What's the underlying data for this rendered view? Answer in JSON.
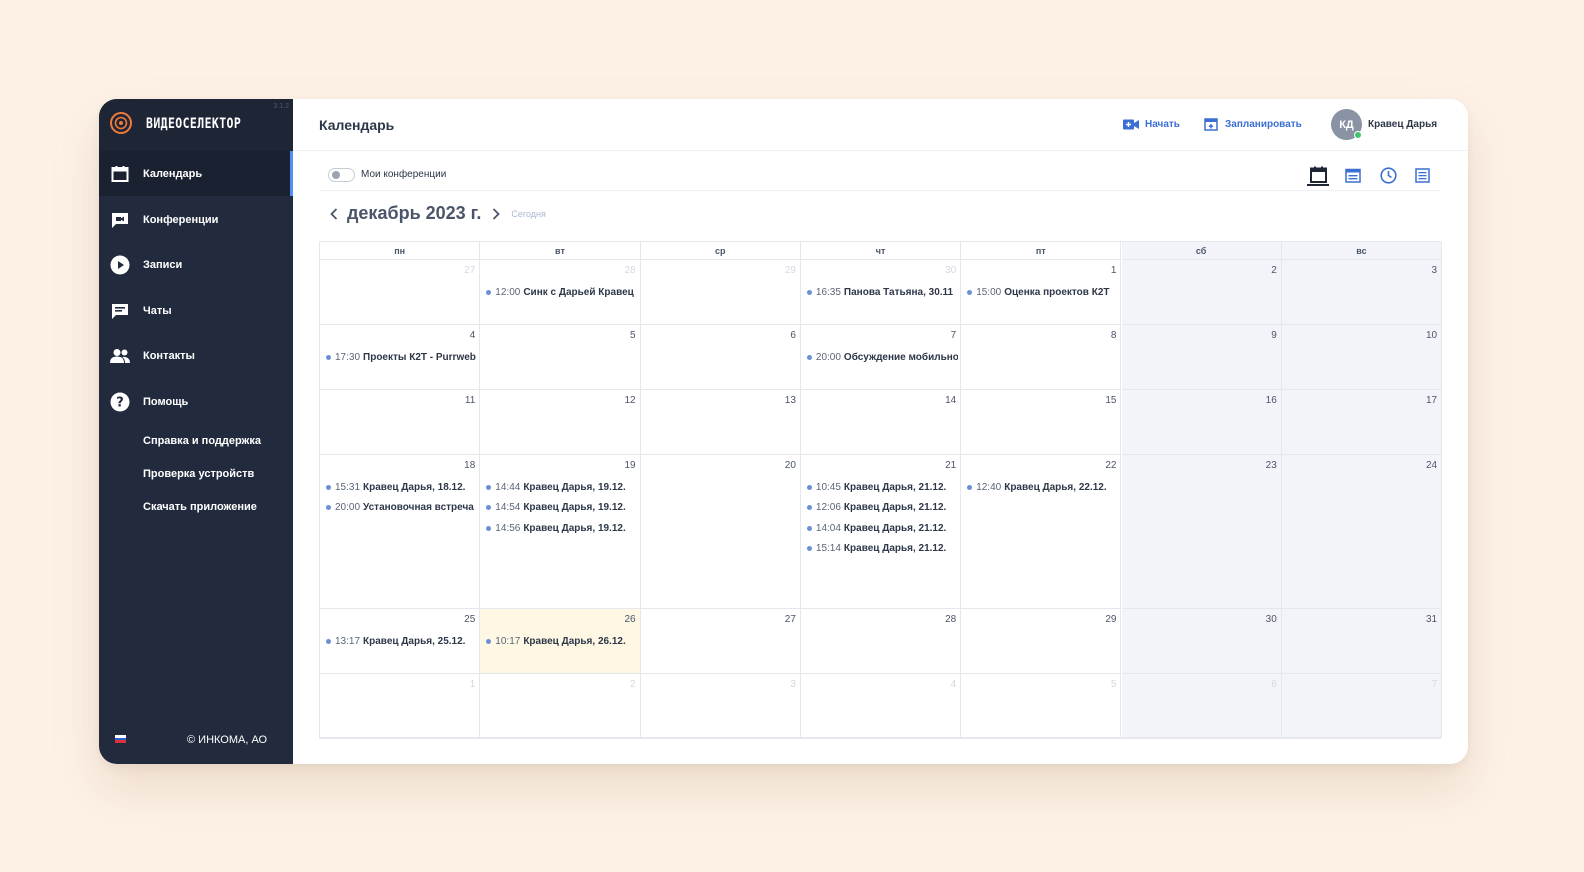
{
  "app": {
    "brand": "ВИДЕОСЕЛЕКТОР",
    "version": "3.1.2"
  },
  "sidebar": {
    "items": [
      {
        "label": "Календарь",
        "icon": "calendar-icon"
      },
      {
        "label": "Конференции",
        "icon": "video-chat-icon"
      },
      {
        "label": "Записи",
        "icon": "play-icon"
      },
      {
        "label": "Чаты",
        "icon": "chat-icon"
      },
      {
        "label": "Контакты",
        "icon": "contacts-icon"
      },
      {
        "label": "Помощь",
        "icon": "help-icon"
      }
    ],
    "help_links": [
      "Справка и поддержка",
      "Проверка устройств",
      "Скачать приложение"
    ],
    "copyright": "© ИНКОМА, АО",
    "language_flag": "ru-flag-icon"
  },
  "header": {
    "title": "Календарь",
    "start_label": "Начать",
    "schedule_label": "Запланировать",
    "user": {
      "initials": "КД",
      "name": "Кравец Дарья"
    }
  },
  "toolbar": {
    "toggle_label": "Мои конференции",
    "toggle_on": false,
    "views": [
      "month-view-icon",
      "week-view-icon",
      "day-view-icon",
      "list-view-icon"
    ],
    "active_view": "month-view-icon"
  },
  "calendar": {
    "month_label": "декабрь 2023 г.",
    "today_label": "Сегодня",
    "weekdays": [
      "пн",
      "вт",
      "ср",
      "чт",
      "пт",
      "сб",
      "вс"
    ],
    "weeks": [
      [
        {
          "day": "27",
          "other": true,
          "events": []
        },
        {
          "day": "28",
          "other": true,
          "events": [
            {
              "time": "12:00",
              "title": "Синк с Дарьей Кравец"
            }
          ]
        },
        {
          "day": "29",
          "other": true,
          "events": []
        },
        {
          "day": "30",
          "other": true,
          "events": [
            {
              "time": "16:35",
              "title": "Панова Татьяна, 30.11"
            }
          ]
        },
        {
          "day": "1",
          "events": [
            {
              "time": "15:00",
              "title": "Оценка проектов К2Т"
            }
          ]
        },
        {
          "day": "2",
          "events": []
        },
        {
          "day": "3",
          "events": []
        }
      ],
      [
        {
          "day": "4",
          "events": [
            {
              "time": "17:30",
              "title": "Проекты К2Т - Purrweb"
            }
          ]
        },
        {
          "day": "5",
          "events": []
        },
        {
          "day": "6",
          "events": []
        },
        {
          "day": "7",
          "events": [
            {
              "time": "20:00",
              "title": "Обсуждение мобильного"
            }
          ]
        },
        {
          "day": "8",
          "events": []
        },
        {
          "day": "9",
          "events": []
        },
        {
          "day": "10",
          "events": []
        }
      ],
      [
        {
          "day": "11",
          "events": []
        },
        {
          "day": "12",
          "events": []
        },
        {
          "day": "13",
          "events": []
        },
        {
          "day": "14",
          "events": []
        },
        {
          "day": "15",
          "events": []
        },
        {
          "day": "16",
          "events": []
        },
        {
          "day": "17",
          "events": []
        }
      ],
      [
        {
          "day": "18",
          "events": [
            {
              "time": "15:31",
              "title": "Кравец Дарья, 18.12."
            },
            {
              "time": "20:00",
              "title": "Установочная встреча"
            }
          ]
        },
        {
          "day": "19",
          "events": [
            {
              "time": "14:44",
              "title": "Кравец Дарья, 19.12."
            },
            {
              "time": "14:54",
              "title": "Кравец Дарья, 19.12."
            },
            {
              "time": "14:56",
              "title": "Кравец Дарья, 19.12."
            }
          ]
        },
        {
          "day": "20",
          "events": []
        },
        {
          "day": "21",
          "events": [
            {
              "time": "10:45",
              "title": "Кравец Дарья, 21.12."
            },
            {
              "time": "12:06",
              "title": "Кравец Дарья, 21.12."
            },
            {
              "time": "14:04",
              "title": "Кравец Дарья, 21.12."
            },
            {
              "time": "15:14",
              "title": "Кравец Дарья, 21.12."
            }
          ]
        },
        {
          "day": "22",
          "events": [
            {
              "time": "12:40",
              "title": "Кравец Дарья, 22.12."
            }
          ]
        },
        {
          "day": "23",
          "events": []
        },
        {
          "day": "24",
          "events": []
        }
      ],
      [
        {
          "day": "25",
          "events": [
            {
              "time": "13:17",
              "title": "Кравец Дарья, 25.12."
            }
          ]
        },
        {
          "day": "26",
          "today": true,
          "events": [
            {
              "time": "10:17",
              "title": "Кравец Дарья, 26.12."
            }
          ]
        },
        {
          "day": "27",
          "events": []
        },
        {
          "day": "28",
          "events": []
        },
        {
          "day": "29",
          "events": []
        },
        {
          "day": "30",
          "events": []
        },
        {
          "day": "31",
          "events": []
        }
      ],
      [
        {
          "day": "1",
          "other": true,
          "events": []
        },
        {
          "day": "2",
          "other": true,
          "events": []
        },
        {
          "day": "3",
          "other": true,
          "events": []
        },
        {
          "day": "4",
          "other": true,
          "events": []
        },
        {
          "day": "5",
          "other": true,
          "events": []
        },
        {
          "day": "6",
          "other": true,
          "events": []
        },
        {
          "day": "7",
          "other": true,
          "events": []
        }
      ]
    ]
  },
  "colors": {
    "sidebar": "#222b3d",
    "accent": "#3b6fd1",
    "event_dot": "#6b8fd6",
    "today_bg": "#fdf7e3",
    "weekend_bg": "#f3f4fa"
  }
}
